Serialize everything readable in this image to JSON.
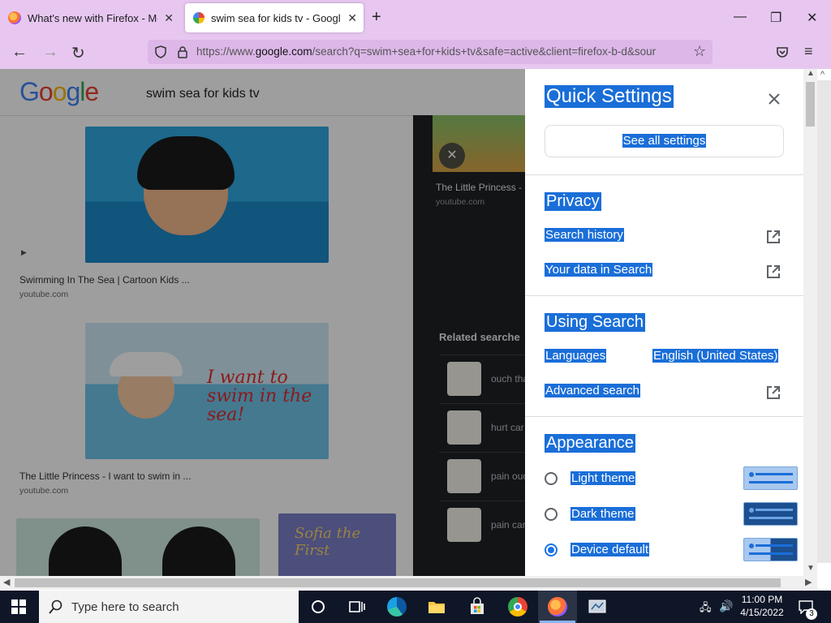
{
  "browser": {
    "tabs": [
      {
        "title": "What's new with Firefox - More",
        "active": false
      },
      {
        "title": "swim sea for kids tv - Google Se",
        "active": true
      }
    ],
    "url_prefix": "https://www.",
    "url_domain": "google.com",
    "url_rest": "/search?q=swim+sea+for+kids+tv&safe=active&client=firefox-b-d&sour"
  },
  "google": {
    "logo": "Google",
    "query": "swim sea for kids tv",
    "results": [
      {
        "caption": "Swimming In The Sea | Cartoon Kids ...",
        "source": "youtube.com"
      },
      {
        "caption": "The Little Princess - I want to swim in ...",
        "source": "youtube.com"
      }
    ],
    "panel_caption": "The Little Princess -",
    "panel_source": "youtube.com",
    "thumb_text": "I want to swim in the sea!",
    "sofia_text": "Sofia the First",
    "related_title": "Related searche",
    "related": [
      "ouch tha",
      "hurt car",
      "pain ouc",
      "pain car"
    ]
  },
  "quick_settings": {
    "title": "Quick Settings",
    "see_all": "See all settings",
    "privacy": {
      "heading": "Privacy",
      "search_history": "Search history",
      "your_data": "Your data in Search"
    },
    "using_search": {
      "heading": "Using Search",
      "languages_label": "Languages",
      "languages_value": "English (United States)",
      "advanced_search": "Advanced search"
    },
    "appearance": {
      "heading": "Appearance",
      "options": [
        {
          "label": "Light theme",
          "selected": false
        },
        {
          "label": "Dark theme",
          "selected": false
        },
        {
          "label": "Device default",
          "selected": true
        }
      ]
    }
  },
  "taskbar": {
    "search_placeholder": "Type here to search",
    "time": "11:00 PM",
    "date": "4/15/2022",
    "notification_count": "3"
  },
  "colors": {
    "browser_chrome": "#e7c7f0",
    "selection": "#1a6ed8",
    "taskbar": "#0f1628",
    "radio_selected": "#1a73e8"
  }
}
